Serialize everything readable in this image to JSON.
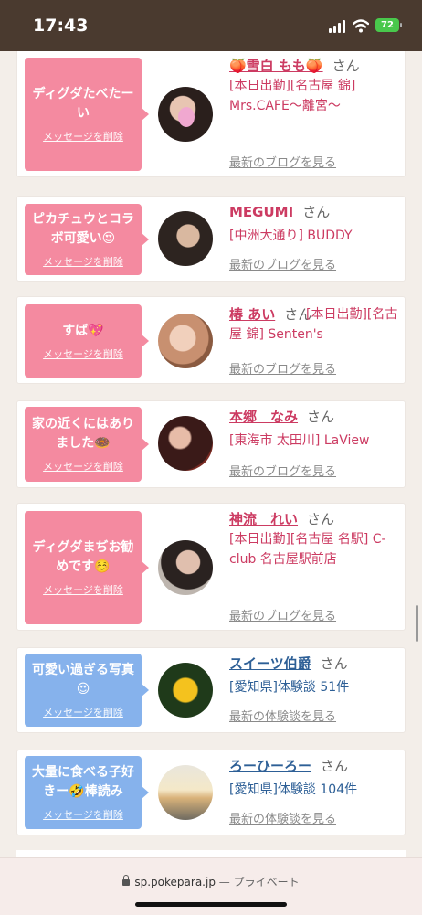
{
  "status": {
    "time": "17:43",
    "battery": "72"
  },
  "delete_label": "メッセージを削除",
  "cards": [
    {
      "type": "pink",
      "msg": [
        "ディグダたべたーい"
      ],
      "name": "🍑雪白 もも🍑",
      "honorific": "さん",
      "detail": "[本日出勤][名古屋 錦] Mrs.CAFE〜離宮〜",
      "link": "最新のブログを見る"
    },
    {
      "type": "pink",
      "msg": [
        "ピカチュウとコラ",
        "ボ可愛い😍"
      ],
      "name": "MEGUMI",
      "honorific": "さん",
      "detail": "[中洲大通り] BUDDY",
      "link": "最新のブログを見る"
    },
    {
      "type": "pink",
      "msg": [
        "すば💖"
      ],
      "name": "椿 あい",
      "honorific": "さん",
      "detail": "[本日出勤][名古屋 錦] Senten's",
      "link": "最新のブログを見る"
    },
    {
      "type": "pink",
      "msg": [
        "家の近くにはあり",
        "ました🍩"
      ],
      "name": "本郷　なみ",
      "honorific": "さん",
      "detail": "[東海市 太田川] LaView",
      "link": "最新のブログを見る"
    },
    {
      "type": "pink",
      "msg": [
        "ディグダまぢお勧",
        "めです☺️"
      ],
      "name": "神流　れい",
      "honorific": "さん",
      "detail": "[本日出勤][名古屋 名駅] C-club 名古屋駅前店",
      "link": "最新のブログを見る"
    },
    {
      "type": "blue",
      "msg": [
        "可愛い過ぎる写真",
        "😍"
      ],
      "name": "スイーツ伯爵",
      "honorific": "さん",
      "detail": "[愛知県]体験談 51件",
      "link": "最新の体験談を見る"
    },
    {
      "type": "blue",
      "msg": [
        "大量に食べる子好",
        "きー🤣棒読み"
      ],
      "name": "ろーひーろー",
      "honorific": "さん",
      "detail": "[愛知県]体験談 104件",
      "link": "最新の体験談を見る"
    }
  ],
  "browser": {
    "domain": "sp.pokepara.jp",
    "privacy": "— プライベート"
  }
}
